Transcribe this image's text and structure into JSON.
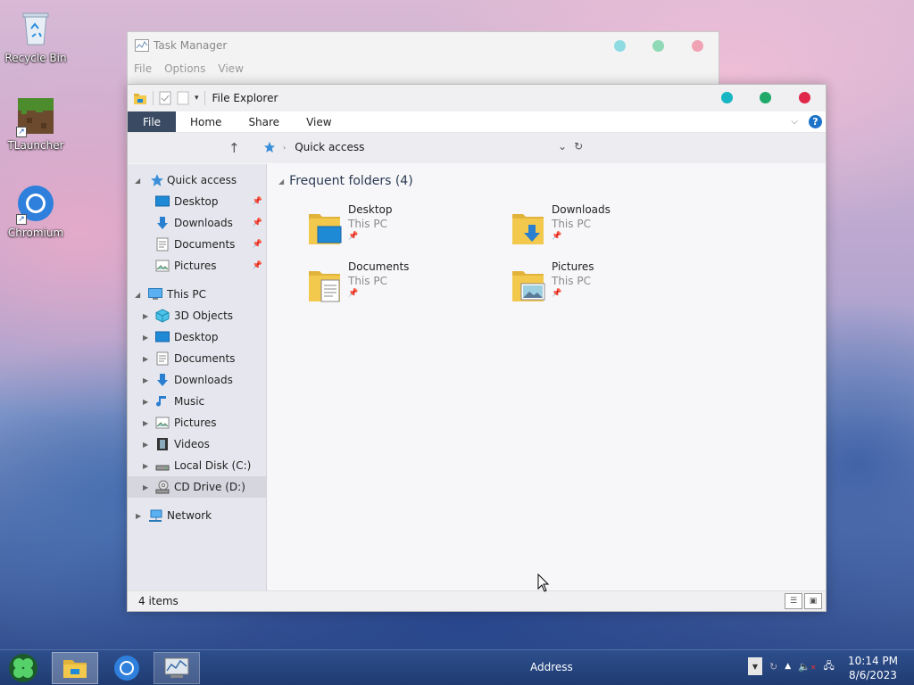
{
  "desktop": {
    "icons": [
      {
        "label": "Recycle Bin"
      },
      {
        "label": "TLauncher"
      },
      {
        "label": "Chromium"
      }
    ]
  },
  "task_manager": {
    "title": "Task Manager",
    "menu": [
      "File",
      "Options",
      "View"
    ]
  },
  "explorer": {
    "title": "File Explorer",
    "ribbon_tabs": [
      "File",
      "Home",
      "Share",
      "View"
    ],
    "address": {
      "location": "Quick access"
    },
    "nav": {
      "quick_access": "Quick access",
      "quick_items": [
        "Desktop",
        "Downloads",
        "Documents",
        "Pictures"
      ],
      "this_pc": "This PC",
      "pc_items": [
        "3D Objects",
        "Desktop",
        "Documents",
        "Downloads",
        "Music",
        "Pictures",
        "Videos",
        "Local Disk (C:)",
        "CD Drive (D:)"
      ],
      "network": "Network"
    },
    "content": {
      "group_title": "Frequent folders (4)",
      "folders": [
        {
          "name": "Desktop",
          "location": "This PC"
        },
        {
          "name": "Downloads",
          "location": "This PC"
        },
        {
          "name": "Documents",
          "location": "This PC"
        },
        {
          "name": "Pictures",
          "location": "This PC"
        }
      ]
    },
    "status": {
      "items": "4 items"
    }
  },
  "taskbar": {
    "address_label": "Address",
    "time": "10:14 PM",
    "date": "8/6/2023"
  },
  "colors": {
    "min_dot": "#17b6c2",
    "max_dot": "#1faa6a",
    "close_dot": "#e0264a",
    "file_tab": "#3a4a63",
    "folder_yellow": "#f2c94c"
  }
}
